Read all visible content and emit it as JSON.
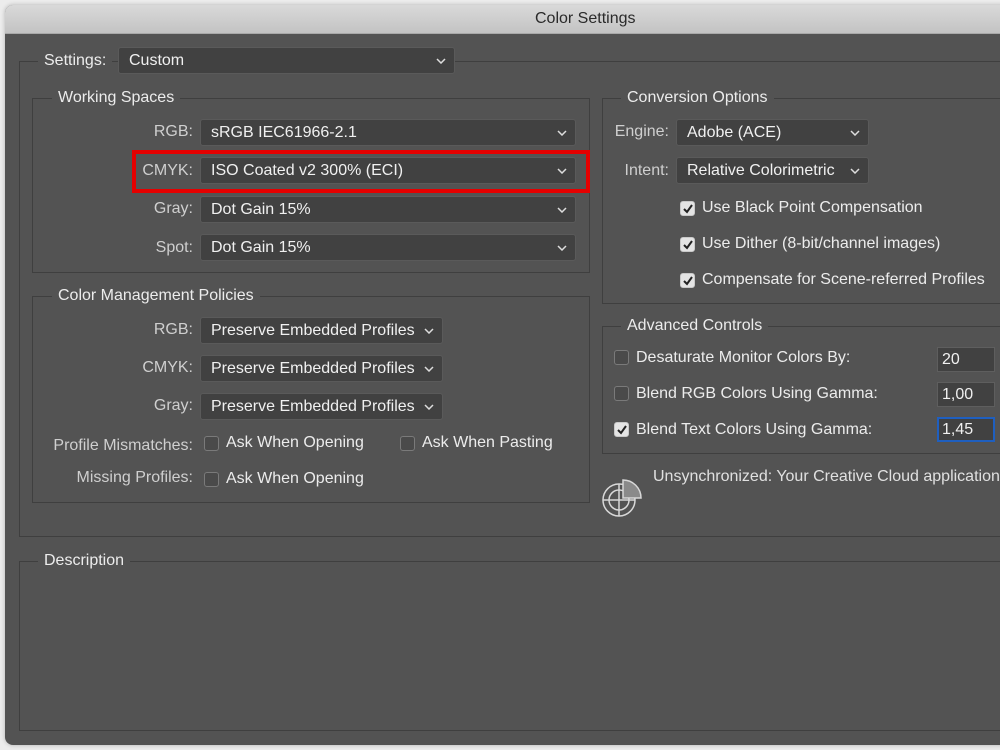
{
  "window": {
    "title": "Color Settings"
  },
  "settings": {
    "label": "Settings:",
    "value": "Custom"
  },
  "working_spaces": {
    "title": "Working Spaces",
    "rows": [
      {
        "label": "RGB:",
        "value": "sRGB IEC61966-2.1"
      },
      {
        "label": "CMYK:",
        "value": "ISO Coated v2 300% (ECI)"
      },
      {
        "label": "Gray:",
        "value": "Dot Gain 15%"
      },
      {
        "label": "Spot:",
        "value": "Dot Gain 15%"
      }
    ]
  },
  "policies": {
    "title": "Color Management Policies",
    "rows": [
      {
        "label": "RGB:",
        "value": "Preserve Embedded Profiles"
      },
      {
        "label": "CMYK:",
        "value": "Preserve Embedded Profiles"
      },
      {
        "label": "Gray:",
        "value": "Preserve Embedded Profiles"
      }
    ],
    "mismatches": {
      "label": "Profile Mismatches:",
      "ask_opening": {
        "label": "Ask When Opening",
        "checked": false
      },
      "ask_pasting": {
        "label": "Ask When Pasting",
        "checked": false
      }
    },
    "missing": {
      "label": "Missing Profiles:",
      "ask_opening": {
        "label": "Ask When Opening",
        "checked": false
      }
    }
  },
  "conversion": {
    "title": "Conversion Options",
    "engine": {
      "label": "Engine:",
      "value": "Adobe (ACE)"
    },
    "intent": {
      "label": "Intent:",
      "value": "Relative Colorimetric"
    },
    "checks": [
      {
        "label": "Use Black Point Compensation",
        "checked": true
      },
      {
        "label": "Use Dither (8-bit/channel images)",
        "checked": true
      },
      {
        "label": "Compensate for Scene-referred Profiles",
        "checked": true
      }
    ]
  },
  "advanced": {
    "title": "Advanced Controls",
    "rows": [
      {
        "label": "Desaturate Monitor Colors By:",
        "checked": false,
        "value": "20"
      },
      {
        "label": "Blend RGB Colors Using Gamma:",
        "checked": false,
        "value": "1,00"
      },
      {
        "label": "Blend Text Colors Using Gamma:",
        "checked": true,
        "value": "1,45"
      }
    ]
  },
  "sync": {
    "icon": "color-sync-icon",
    "text": "Unsynchronized: Your Creative Cloud applications are not synchronized for consistent color."
  },
  "description": {
    "title": "Description"
  },
  "colors": {
    "highlight": "#e50000",
    "focus": "#1f5fbf",
    "panel": "#535353"
  }
}
